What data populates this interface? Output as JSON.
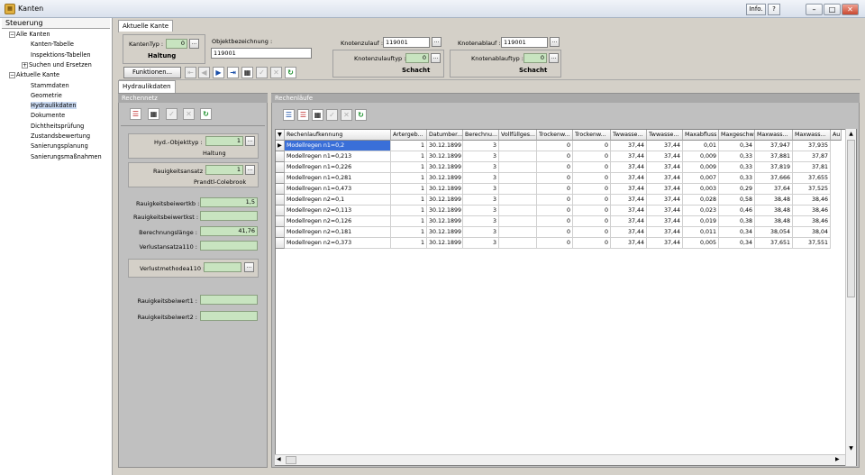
{
  "window": {
    "title": "Kanten",
    "info_label": "Info.",
    "help_label": "?",
    "minimize_label": "–",
    "maximize_label": "□",
    "close_label": "✕"
  },
  "left": {
    "header": "Steuerung",
    "tree": [
      {
        "label": "Alle Kanten",
        "exp": "−"
      },
      {
        "label": "Kanten-Tabelle"
      },
      {
        "label": "Inspektions-Tabellen"
      },
      {
        "label": "Suchen und Ersetzen",
        "exp": "+"
      },
      {
        "label": "Aktuelle Kante",
        "exp": "−"
      },
      {
        "label": "Stammdaten"
      },
      {
        "label": "Geometrie"
      },
      {
        "label": "Hydraulikdaten"
      },
      {
        "label": "Dokumente"
      },
      {
        "label": "Dichtheitsprüfung"
      },
      {
        "label": "Zustandsbewertung"
      },
      {
        "label": "Sanierungsplanung"
      },
      {
        "label": "Sanierungsmaßnahmen"
      }
    ]
  },
  "tabs": {
    "aktuelle_kante": "Aktuelle Kante",
    "hydraulik": "Hydraulikdaten"
  },
  "top": {
    "kantentyp_label": "KantenTyp :",
    "kantentyp_value": "0",
    "kantentyp_text": "Haltung",
    "objektbez_label": "Objektbezeichnung :",
    "objektbez_value": "119001",
    "knotenzulauf_label": "Knotenzulauf :",
    "knotenzulauf_value": "119001",
    "knotenablauf_label": "Knotenablauf :",
    "knotenablauf_value": "119001",
    "zulauftyp_label": "Knotenzulauftyp :",
    "zulauftyp_value": "0",
    "zulauftyp_text": "Schacht",
    "ablauftyp_label": "Knotenablauftyp :",
    "ablauftyp_value": "0",
    "ablauftyp_text": "Schacht",
    "funktionen_label": "Funktionen..."
  },
  "rechennetz": {
    "header": "Rechennetz",
    "hyd_label": "Hyd.-Objekttyp :",
    "hyd_value": "1",
    "hyd_text": "Haltung",
    "rauh_label": "Rauigkeitsansatz :",
    "rauh_value": "1",
    "rauh_text": "Prandtl-Colebrook",
    "kb_label": "Rauigkeitsbeiwertkb :",
    "kb_value": "1,5",
    "kst_label": "Rauigkeitsbeiwertkst :",
    "kst_value": "",
    "laenge_label": "Berechnungslänge :",
    "laenge_value": "41,76",
    "verlust_label": "Verlustansatza110 :",
    "verlust_value": "",
    "methode_label": "Verlustmethodea110 :",
    "methode_value": "",
    "b1_label": "Rauigkeitsbeiwert1 :",
    "b1_value": "",
    "b2_label": "Rauigkeitsbeiwert2 :",
    "b2_value": ""
  },
  "rechenlaeufe": {
    "header": "Rechenläufe",
    "columns": [
      "Rechenlaufkennung",
      "Artergeb...",
      "Datumber...",
      "Berechnu...",
      "Vollfüllges...",
      "Trockenw...",
      "Trockenw...",
      "Twwasse...",
      "Twwasse...",
      "Maxabfluss",
      "Maxgeschw",
      "Maxwass...",
      "Maxwass...",
      "Au"
    ],
    "rows": [
      [
        "Modellregen n1=0,2",
        "1",
        "30.12.1899",
        "3",
        "",
        "0",
        "0",
        "37,44",
        "37,44",
        "0,01",
        "0,34",
        "37,947",
        "37,935"
      ],
      [
        "Modellregen n1=0,213",
        "1",
        "30.12.1899",
        "3",
        "",
        "0",
        "0",
        "37,44",
        "37,44",
        "0,009",
        "0,33",
        "37,881",
        "37,87"
      ],
      [
        "Modellregen n1=0,226",
        "1",
        "30.12.1899",
        "3",
        "",
        "0",
        "0",
        "37,44",
        "37,44",
        "0,009",
        "0,33",
        "37,819",
        "37,81"
      ],
      [
        "Modellregen n1=0,281",
        "1",
        "30.12.1899",
        "3",
        "",
        "0",
        "0",
        "37,44",
        "37,44",
        "0,007",
        "0,33",
        "37,666",
        "37,655"
      ],
      [
        "Modellregen n1=0,473",
        "1",
        "30.12.1899",
        "3",
        "",
        "0",
        "0",
        "37,44",
        "37,44",
        "0,003",
        "0,29",
        "37,64",
        "37,525"
      ],
      [
        "Modellregen n2=0,1",
        "1",
        "30.12.1899",
        "3",
        "",
        "0",
        "0",
        "37,44",
        "37,44",
        "0,028",
        "0,58",
        "38,48",
        "38,46"
      ],
      [
        "Modellregen n2=0,113",
        "1",
        "30.12.1899",
        "3",
        "",
        "0",
        "0",
        "37,44",
        "37,44",
        "0,023",
        "0,46",
        "38,48",
        "38,46"
      ],
      [
        "Modellregen n2=0,126",
        "1",
        "30.12.1899",
        "3",
        "",
        "0",
        "0",
        "37,44",
        "37,44",
        "0,019",
        "0,38",
        "38,48",
        "38,46"
      ],
      [
        "Modellregen n2=0,181",
        "1",
        "30.12.1899",
        "3",
        "",
        "0",
        "0",
        "37,44",
        "37,44",
        "0,011",
        "0,34",
        "38,054",
        "38,04"
      ],
      [
        "Modellregen n2=0,373",
        "1",
        "30.12.1899",
        "3",
        "",
        "0",
        "0",
        "37,44",
        "37,44",
        "0,005",
        "0,34",
        "37,651",
        "37,551"
      ]
    ]
  }
}
